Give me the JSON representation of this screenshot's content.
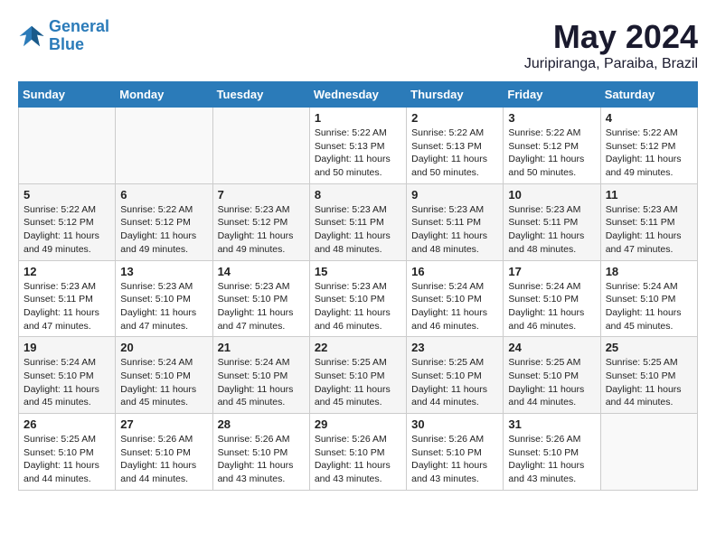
{
  "logo": {
    "line1": "General",
    "line2": "Blue"
  },
  "title": "May 2024",
  "location": "Juripiranga, Paraiba, Brazil",
  "weekdays": [
    "Sunday",
    "Monday",
    "Tuesday",
    "Wednesday",
    "Thursday",
    "Friday",
    "Saturday"
  ],
  "weeks": [
    [
      {
        "day": "",
        "info": ""
      },
      {
        "day": "",
        "info": ""
      },
      {
        "day": "",
        "info": ""
      },
      {
        "day": "1",
        "info": "Sunrise: 5:22 AM\nSunset: 5:13 PM\nDaylight: 11 hours\nand 50 minutes."
      },
      {
        "day": "2",
        "info": "Sunrise: 5:22 AM\nSunset: 5:13 PM\nDaylight: 11 hours\nand 50 minutes."
      },
      {
        "day": "3",
        "info": "Sunrise: 5:22 AM\nSunset: 5:12 PM\nDaylight: 11 hours\nand 50 minutes."
      },
      {
        "day": "4",
        "info": "Sunrise: 5:22 AM\nSunset: 5:12 PM\nDaylight: 11 hours\nand 49 minutes."
      }
    ],
    [
      {
        "day": "5",
        "info": "Sunrise: 5:22 AM\nSunset: 5:12 PM\nDaylight: 11 hours\nand 49 minutes."
      },
      {
        "day": "6",
        "info": "Sunrise: 5:22 AM\nSunset: 5:12 PM\nDaylight: 11 hours\nand 49 minutes."
      },
      {
        "day": "7",
        "info": "Sunrise: 5:23 AM\nSunset: 5:12 PM\nDaylight: 11 hours\nand 49 minutes."
      },
      {
        "day": "8",
        "info": "Sunrise: 5:23 AM\nSunset: 5:11 PM\nDaylight: 11 hours\nand 48 minutes."
      },
      {
        "day": "9",
        "info": "Sunrise: 5:23 AM\nSunset: 5:11 PM\nDaylight: 11 hours\nand 48 minutes."
      },
      {
        "day": "10",
        "info": "Sunrise: 5:23 AM\nSunset: 5:11 PM\nDaylight: 11 hours\nand 48 minutes."
      },
      {
        "day": "11",
        "info": "Sunrise: 5:23 AM\nSunset: 5:11 PM\nDaylight: 11 hours\nand 47 minutes."
      }
    ],
    [
      {
        "day": "12",
        "info": "Sunrise: 5:23 AM\nSunset: 5:11 PM\nDaylight: 11 hours\nand 47 minutes."
      },
      {
        "day": "13",
        "info": "Sunrise: 5:23 AM\nSunset: 5:10 PM\nDaylight: 11 hours\nand 47 minutes."
      },
      {
        "day": "14",
        "info": "Sunrise: 5:23 AM\nSunset: 5:10 PM\nDaylight: 11 hours\nand 47 minutes."
      },
      {
        "day": "15",
        "info": "Sunrise: 5:23 AM\nSunset: 5:10 PM\nDaylight: 11 hours\nand 46 minutes."
      },
      {
        "day": "16",
        "info": "Sunrise: 5:24 AM\nSunset: 5:10 PM\nDaylight: 11 hours\nand 46 minutes."
      },
      {
        "day": "17",
        "info": "Sunrise: 5:24 AM\nSunset: 5:10 PM\nDaylight: 11 hours\nand 46 minutes."
      },
      {
        "day": "18",
        "info": "Sunrise: 5:24 AM\nSunset: 5:10 PM\nDaylight: 11 hours\nand 45 minutes."
      }
    ],
    [
      {
        "day": "19",
        "info": "Sunrise: 5:24 AM\nSunset: 5:10 PM\nDaylight: 11 hours\nand 45 minutes."
      },
      {
        "day": "20",
        "info": "Sunrise: 5:24 AM\nSunset: 5:10 PM\nDaylight: 11 hours\nand 45 minutes."
      },
      {
        "day": "21",
        "info": "Sunrise: 5:24 AM\nSunset: 5:10 PM\nDaylight: 11 hours\nand 45 minutes."
      },
      {
        "day": "22",
        "info": "Sunrise: 5:25 AM\nSunset: 5:10 PM\nDaylight: 11 hours\nand 45 minutes."
      },
      {
        "day": "23",
        "info": "Sunrise: 5:25 AM\nSunset: 5:10 PM\nDaylight: 11 hours\nand 44 minutes."
      },
      {
        "day": "24",
        "info": "Sunrise: 5:25 AM\nSunset: 5:10 PM\nDaylight: 11 hours\nand 44 minutes."
      },
      {
        "day": "25",
        "info": "Sunrise: 5:25 AM\nSunset: 5:10 PM\nDaylight: 11 hours\nand 44 minutes."
      }
    ],
    [
      {
        "day": "26",
        "info": "Sunrise: 5:25 AM\nSunset: 5:10 PM\nDaylight: 11 hours\nand 44 minutes."
      },
      {
        "day": "27",
        "info": "Sunrise: 5:26 AM\nSunset: 5:10 PM\nDaylight: 11 hours\nand 44 minutes."
      },
      {
        "day": "28",
        "info": "Sunrise: 5:26 AM\nSunset: 5:10 PM\nDaylight: 11 hours\nand 43 minutes."
      },
      {
        "day": "29",
        "info": "Sunrise: 5:26 AM\nSunset: 5:10 PM\nDaylight: 11 hours\nand 43 minutes."
      },
      {
        "day": "30",
        "info": "Sunrise: 5:26 AM\nSunset: 5:10 PM\nDaylight: 11 hours\nand 43 minutes."
      },
      {
        "day": "31",
        "info": "Sunrise: 5:26 AM\nSunset: 5:10 PM\nDaylight: 11 hours\nand 43 minutes."
      },
      {
        "day": "",
        "info": ""
      }
    ]
  ]
}
